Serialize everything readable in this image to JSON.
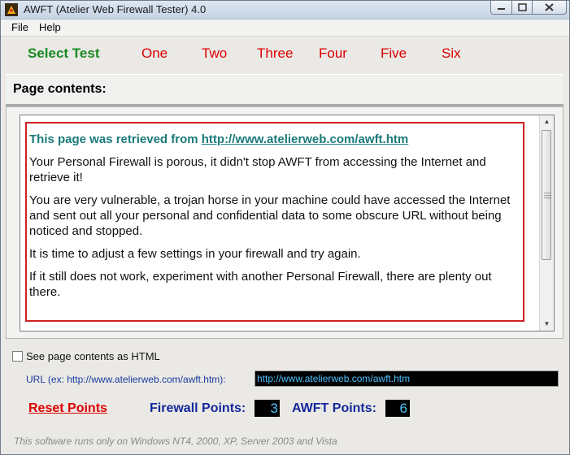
{
  "window": {
    "title": "AWFT (Atelier Web Firewall Tester) 4.0"
  },
  "menu": {
    "file": "File",
    "help": "Help"
  },
  "tabs": [
    "Select Test",
    "One",
    "Two",
    "Three",
    "Four",
    "Five",
    "Six"
  ],
  "header": {
    "label": "Page contents:"
  },
  "browser": {
    "retrieved_prefix": "This page was retrieved from ",
    "retrieved_url": "http://www.atelierweb.com/awft.htm",
    "paragraphs": [
      "Your Personal Firewall is porous, it didn't stop AWFT from accessing the Internet and retrieve it!",
      "You are very vulnerable, a trojan horse in your machine could have accessed the Internet and sent out all your personal and confidential data to some obscure URL without being noticed and stopped.",
      "It is time to adjust a few settings in your firewall and try again.",
      "If it still does not work, experiment with another Personal Firewall, there are plenty out there."
    ]
  },
  "controls": {
    "html_checkbox_label": "See page contents as HTML",
    "url_label": "URL (ex: http://www.atelierweb.com/awft.htm):",
    "url_value": "http://www.atelierweb.com/awft.htm",
    "reset_label": "Reset Points",
    "firewall_points_label": "Firewall Points:",
    "firewall_points": "3",
    "awft_points_label": "AWFT Points:",
    "awft_points": "6"
  },
  "footer": {
    "text": "This software runs only on Windows NT4, 2000, XP, Server 2003 and Vista"
  },
  "colors": {
    "tab_active": "#1a8a22",
    "tab": "#dd0000",
    "points_bg": "#000000",
    "points_text": "#4fc2ff",
    "label_blue": "#14289c"
  }
}
